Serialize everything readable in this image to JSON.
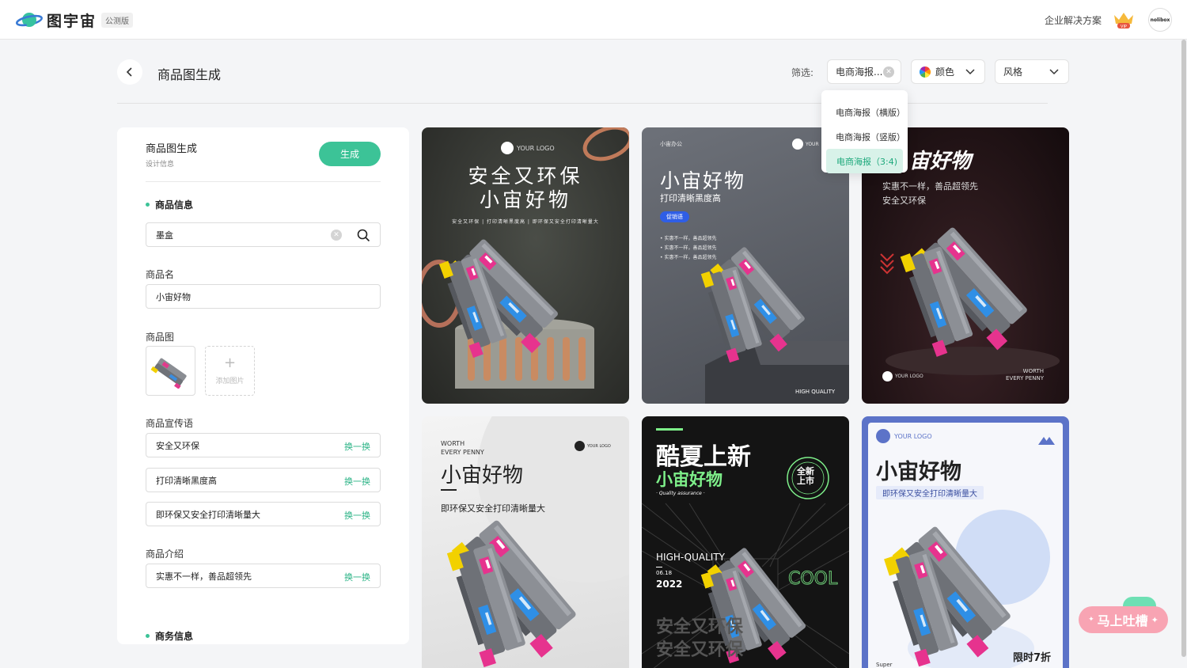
{
  "app": {
    "name": "图宇宙",
    "badge": "公测版"
  },
  "header": {
    "enterprise_link": "企业解决方案",
    "vip_label": "VIP",
    "avatar_text": "nolibox"
  },
  "page": {
    "title": "商品图生成"
  },
  "filters": {
    "label": "筛选:",
    "type_value": "电商海报...",
    "color_label": "颜色",
    "style_label": "风格",
    "type_options": [
      "电商海报（横版）",
      "电商海报（竖版）",
      "电商海报（3:4)"
    ],
    "type_selected_index": 2
  },
  "panel": {
    "title": "商品图生成",
    "subtitle": "设计信息",
    "generate_button": "生成",
    "product_section": "商品信息",
    "search_value": "墨盒",
    "name_label": "商品名",
    "name_value": "小宙好物",
    "image_label": "商品图",
    "add_image": "添加图片",
    "slogan_label": "商品宣传语",
    "slogans": [
      "安全又环保",
      "打印清晰黑度高",
      "即环保又安全打印清晰量大"
    ],
    "swap_label": "换一换",
    "intro_label": "商品介绍",
    "intro_value": "实惠不一样，善品超领先",
    "business_section": "商务信息"
  },
  "cards": {
    "c1": {
      "logo": "YOUR LOGO",
      "line1": "安全又环保",
      "line2": "小宙好物",
      "small": "安全又环保 | 打印清晰黑度高 | 即环保又安全打印清晰量大"
    },
    "c2": {
      "tag": "小宙办公",
      "logo": "YOUR",
      "title": "小宙好物",
      "sub": "打印清晰黑度高",
      "badge": "促销语",
      "bullets": [
        "• 实惠不一样，善品超领先",
        "• 实惠不一样，善品超领先",
        "• 实惠不一样，善品超领先"
      ],
      "footer": "HIGH QUALITY"
    },
    "c3": {
      "title": "宙好物",
      "line1": "实惠不一样，善品超领先",
      "line2": "安全又环保",
      "logo": "YOUR LOGO",
      "footer1": "WORTH",
      "footer2": "EVERY PENNY"
    },
    "c4": {
      "top1": "WORTH",
      "top2": "EVERY PENNY",
      "logo": "YOUR LOGO",
      "title": "小宙好物",
      "sub": "即环保又安全打印清晰量大"
    },
    "c5": {
      "title1": "酷夏上新",
      "title2": "小宙好物",
      "qa": "· Quality assurance ·",
      "circle1": "全新",
      "circle2": "上市",
      "hq": "HIGH-QUALITY",
      "date": "06.18",
      "year": "2022",
      "big1": "安全又环保",
      "big2": "安全又环保",
      "cool": "COOL"
    },
    "c6": {
      "logo": "YOUR LOGO",
      "title": "小宙好物",
      "sub": "即环保又安全打印清晰量大",
      "discount": "限时7折",
      "super": "Super"
    }
  },
  "feedback_button": "马上吐槽"
}
